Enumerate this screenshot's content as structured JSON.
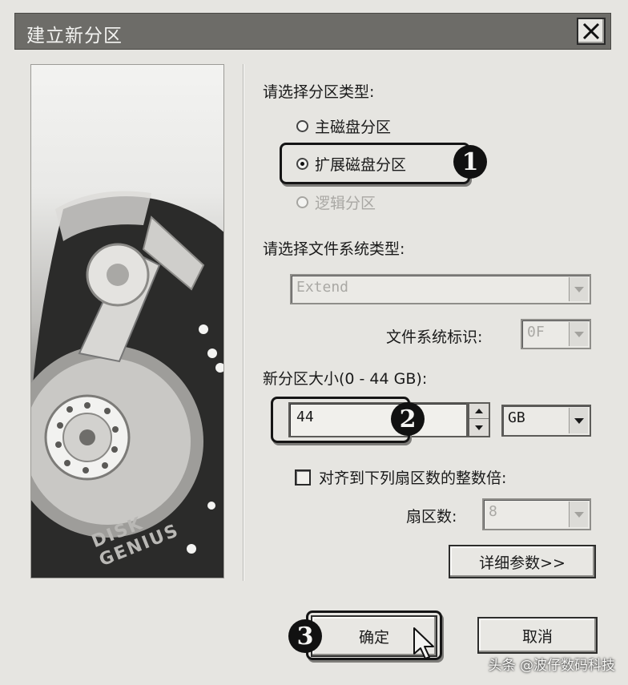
{
  "window": {
    "title": "建立新分区"
  },
  "image_panel": {
    "brand": "DISK GENIUS"
  },
  "partition_type": {
    "label": "请选择分区类型:",
    "options": [
      {
        "label": "主磁盘分区",
        "checked": false,
        "enabled": true
      },
      {
        "label": "扩展磁盘分区",
        "checked": true,
        "enabled": true
      },
      {
        "label": "逻辑分区",
        "checked": false,
        "enabled": false
      }
    ]
  },
  "filesystem": {
    "label": "请选择文件系统类型:",
    "value": "Extend",
    "id_label": "文件系统标识:",
    "id_value": "0F"
  },
  "size": {
    "label": "新分区大小(0 - 44 GB):",
    "value": "44",
    "unit": "GB"
  },
  "align": {
    "label": "对齐到下列扇区数的整数倍:",
    "checked": false,
    "sectors_label": "扇区数:",
    "sectors_value": "8"
  },
  "buttons": {
    "details": "详细参数>>",
    "ok": "确定",
    "cancel": "取消"
  },
  "steps": [
    "1",
    "2",
    "3"
  ],
  "watermark": "头条 @波仔数码科技"
}
